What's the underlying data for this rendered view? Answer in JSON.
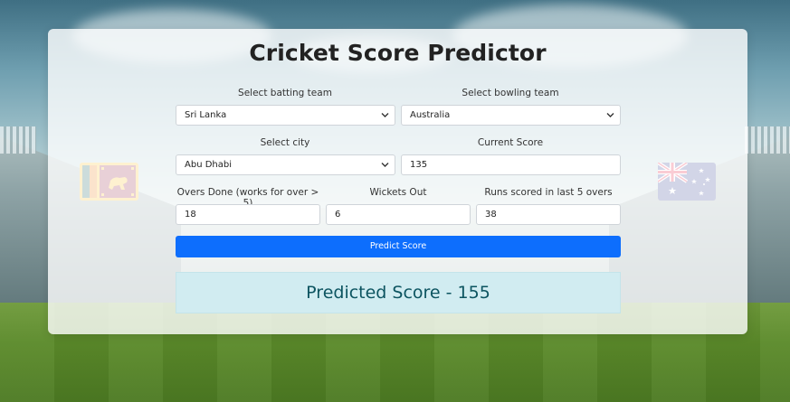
{
  "title": "Cricket Score Predictor",
  "batting_team": {
    "label": "Select batting team",
    "value": "Sri Lanka"
  },
  "bowling_team": {
    "label": "Select bowling team",
    "value": "Australia"
  },
  "city": {
    "label": "Select city",
    "value": "Abu Dhabi"
  },
  "current_score": {
    "label": "Current Score",
    "value": "135"
  },
  "overs_done": {
    "label": "Overs Done (works for over > 5)",
    "value": "18"
  },
  "wickets_out": {
    "label": "Wickets Out",
    "value": "6"
  },
  "runs_last_5": {
    "label": "Runs scored in last 5 overs",
    "value": "38"
  },
  "predict_button": "Predict Score",
  "result_text": "Predicted Score - 155",
  "flags": {
    "batting": "sri-lanka-flag",
    "bowling": "australia-flag"
  },
  "colors": {
    "button": "#0d6efd",
    "result_bg": "#d1ecf1",
    "result_text": "#0c5460"
  }
}
